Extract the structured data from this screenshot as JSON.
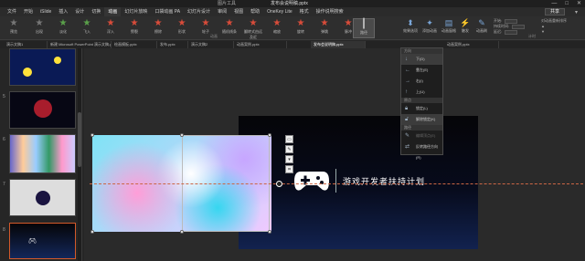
{
  "titlebar": {
    "context": "图片工具",
    "document": "发布会说明稿.pptx",
    "buttons": [
      "—",
      "□",
      "✕"
    ]
  },
  "menu": {
    "tabs": [
      "文件",
      "开始",
      "iSlide",
      "插入",
      "设计",
      "切换",
      "动画",
      "幻灯片放映",
      "口袋动画 PA",
      "幻灯片设计",
      "审阅",
      "视图",
      "帮助",
      "OneKey Lite",
      "格式",
      "操作说明搜索"
    ],
    "share": "共享"
  },
  "ribbon": {
    "preview_label": "预览",
    "animations": [
      "出现",
      "淡化",
      "飞入",
      "浮入",
      "劈裂",
      "擦除",
      "形状",
      "轮子",
      "随机线条",
      "翻转式由远及近",
      "缩放",
      "旋转",
      "弹跳",
      "脉冲",
      "路径"
    ],
    "group_label": "动画",
    "effect_options": "效果选项",
    "add_animation": "添加动画",
    "animation_pane": "动画窗格",
    "trigger": "触发",
    "painter": "动画刷",
    "start_label": "开始:",
    "duration_label": "持续时间:",
    "delay_label": "延迟:",
    "timing_group": "计时",
    "reorder": "对动画重新排序"
  },
  "doc_tabs": [
    "演示文稿1",
    "新建 Microsoft PowerPoint 演示文稿.pptx",
    "绘画模板.pptx",
    "发布.pptx",
    "演示文稿2",
    "动画案例.pptx",
    "发布会说明稿.pptx",
    "动画案例.pptx"
  ],
  "slides": {
    "numbers": [
      "5",
      "6",
      "7",
      "8",
      "9"
    ]
  },
  "dropdown": {
    "sections": [
      "方向",
      "原点",
      "路径"
    ],
    "items": [
      "下(D)",
      "靠左(E)",
      "右(I)",
      "上(U)",
      "锁定(L)",
      "解除锁定(K)",
      "编辑顶点(E)",
      "反转路径方向(R)"
    ]
  },
  "slide": {
    "title": "游戏开发者扶持计划"
  }
}
